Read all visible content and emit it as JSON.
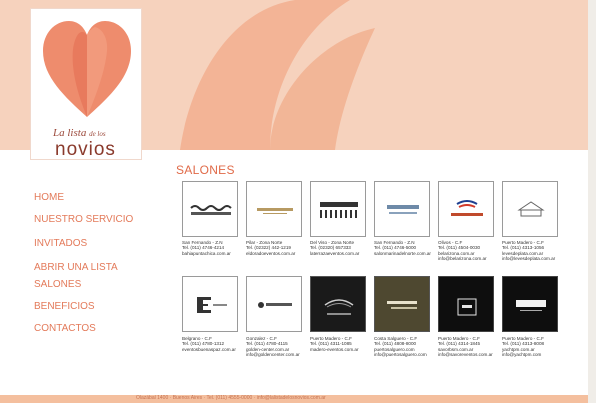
{
  "colors": {
    "banner": "#f6d2bd",
    "accent": "#e37a5a",
    "heart": "#ee8c6d",
    "footer": "#f4bf9e"
  },
  "logo": {
    "small_text_1": "La lista",
    "small_text_2": "de los",
    "big_text": "novios"
  },
  "nav": {
    "items": [
      {
        "label": "HOME"
      },
      {
        "label": "NUESTRO SERVICIO"
      },
      {
        "label": "INVITADOS"
      },
      {
        "label": "ABRIR UNA LISTA"
      },
      {
        "label": "SALONES"
      },
      {
        "label": "BENEFICIOS"
      },
      {
        "label": "CONTACTOS"
      }
    ]
  },
  "main": {
    "title": "SALONES",
    "venues": [
      {
        "logo": "bahia | punta chica",
        "lines": [
          "San Fernando - Z.N",
          "Tel. (011) 4746-4214",
          "bahiapuntachica.com.ar"
        ]
      },
      {
        "logo": "EL DORADO EVENTOS",
        "lines": [
          "Pilar - Zona Norte",
          "Tel. (02322) 442-1219",
          "eldoradoeventos.com.ar"
        ]
      },
      {
        "logo": "la terraza",
        "lines": [
          "Del Viso - Zona Norte",
          "Tel. (02320) 657333",
          "laterrazaeventos.com.ar"
        ]
      },
      {
        "logo": "MARINA DEL NORTE",
        "lines": [
          "San Fernando - Z.N",
          "Tel. (011) 4746-5000",
          "salonmarinadelnorte.com.ar"
        ]
      },
      {
        "logo": "belarizona",
        "lines": [
          "Olivos - C.F",
          "Tel. (011) 4504-0030",
          "belarizona.com.ar",
          "info@belarizona.com.ar"
        ]
      },
      {
        "logo": "Puerto Madero",
        "lines": [
          "Puerto Madero - C.F",
          "Tel. (011) 4313-1056",
          "levesdeplata.com.ar",
          "info@levesdeplata.com.ar"
        ]
      },
      {
        "logo": "E EVENTOS",
        "lines": [
          "Belgrano - C.F",
          "Tel. (011) 4780-1312",
          "eventosbuenaspaz.com.ar"
        ]
      },
      {
        "logo": "GOLDEN CENTER",
        "lines": [
          "Gonzalez - C.F",
          "Tel. (011) 4780-4115",
          "golden-center.com.ar",
          "info@goldencenter.com.ar"
        ]
      },
      {
        "logo": "CAMPANILE",
        "lines": [
          "Puerto Madero - C.F",
          "Tel. (011) 4311-1085",
          "madero-eventos.com.ar"
        ]
      },
      {
        "logo": "PUERTO SALGUERO",
        "lines": [
          "Costa Salguero - C.F",
          "Tel. (011) 4808-8000",
          "puertosalguero.com",
          "info@puertosalguero.com"
        ]
      },
      {
        "logo": "SAVOR",
        "lines": [
          "Puerto Madero - C.F",
          "Tel. (011) 4314-1845",
          "savorbsm.com.ar",
          "info@savoreventos.com.ar"
        ]
      },
      {
        "logo": "YACHT",
        "lines": [
          "Puerto Madero - C.F",
          "Tel. (011) 4313-8008",
          "yachtpm.com.ar",
          "info@yachtpm.com"
        ]
      }
    ]
  },
  "footer": {
    "text": "Olazábal 1400 · Buenos Aires · Tel. (011) 4555-0000 · info@lalistadelosnovios.com.ar"
  }
}
